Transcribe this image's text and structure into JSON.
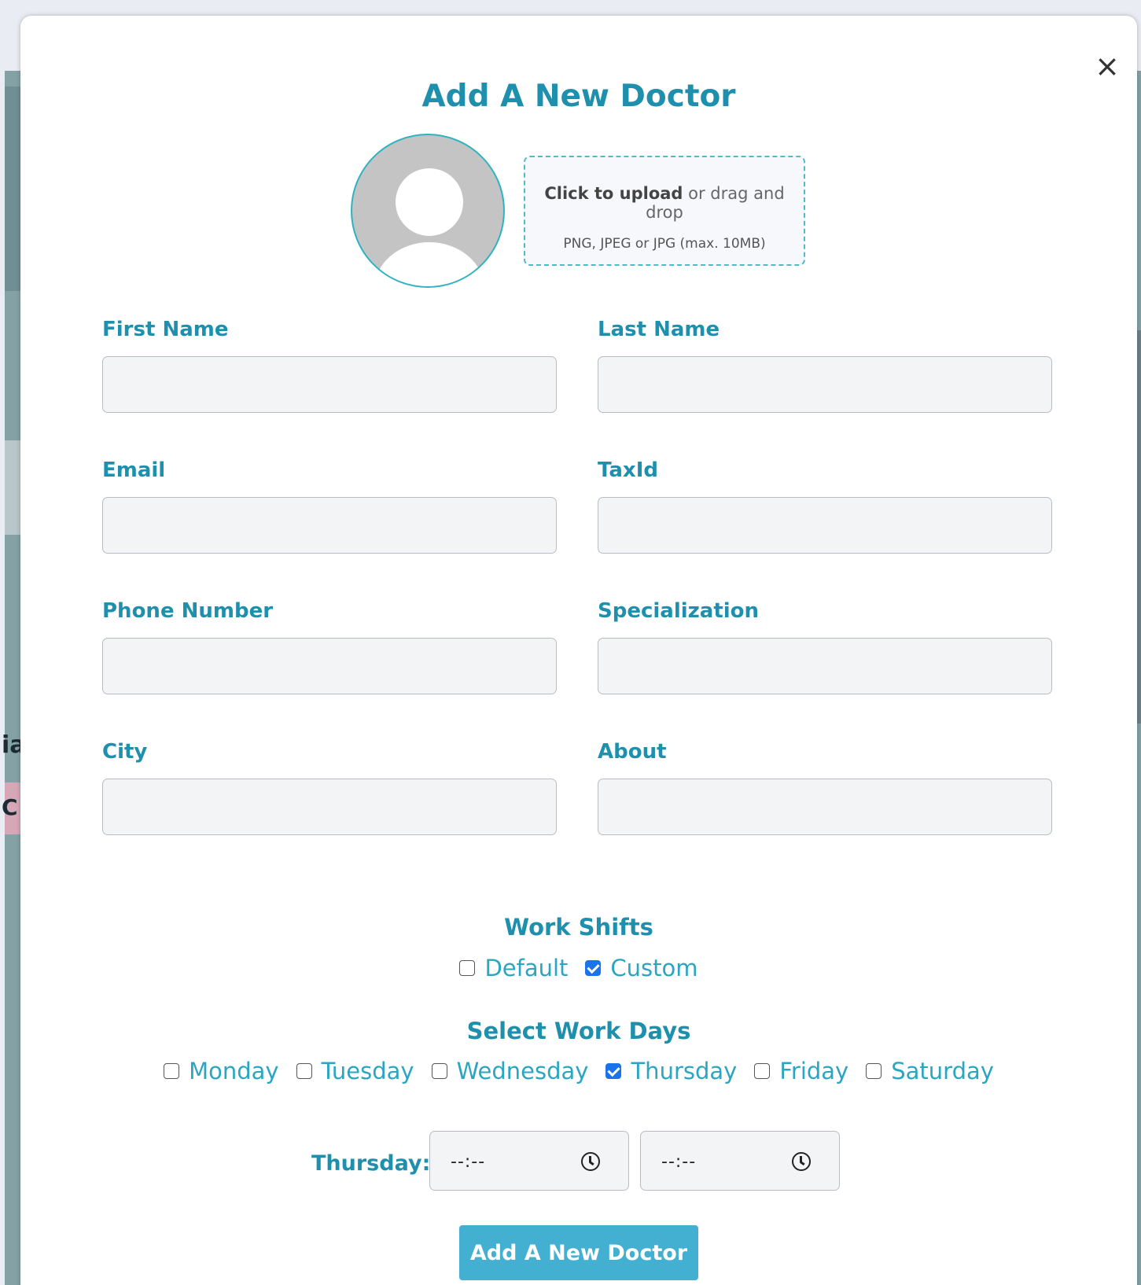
{
  "modal": {
    "title": "Add A New Doctor",
    "close_symbol": "×",
    "close_icon": "close-icon"
  },
  "upload": {
    "click_text": "Click to upload",
    "rest_text": " or drag and drop",
    "formats": "PNG, JPEG or JPG (max. 10MB)"
  },
  "avatar": {
    "icon": "user-placeholder-icon"
  },
  "fields": {
    "first_name": {
      "label": "First Name",
      "value": ""
    },
    "last_name": {
      "label": "Last Name",
      "value": ""
    },
    "email": {
      "label": "Email",
      "value": ""
    },
    "tax_id": {
      "label": "TaxId",
      "value": ""
    },
    "phone": {
      "label": "Phone Number",
      "value": ""
    },
    "specialization": {
      "label": "Specialization",
      "value": ""
    },
    "city": {
      "label": "City",
      "value": ""
    },
    "about": {
      "label": "About",
      "value": ""
    }
  },
  "work_shifts": {
    "heading": "Work Shifts",
    "options": [
      {
        "label": "Default",
        "checked": false
      },
      {
        "label": "Custom",
        "checked": true
      }
    ]
  },
  "work_days": {
    "heading": "Select Work Days",
    "days": [
      {
        "label": "Monday",
        "checked": false
      },
      {
        "label": "Tuesday",
        "checked": false
      },
      {
        "label": "Wednesday",
        "checked": false
      },
      {
        "label": "Thursday",
        "checked": true
      },
      {
        "label": "Friday",
        "checked": false
      },
      {
        "label": "Saturday",
        "checked": false
      }
    ]
  },
  "time_slot": {
    "day_label": "Thursday:",
    "start": "--:--",
    "end": "--:--"
  },
  "submit": {
    "label": "Add A New Doctor"
  },
  "background": {
    "fragment_1": "ia",
    "fragment_2": "C"
  },
  "colors": {
    "primary": "#1e8fad",
    "button": "#43b0d1",
    "checkbox_checked": "#1a73e8"
  }
}
